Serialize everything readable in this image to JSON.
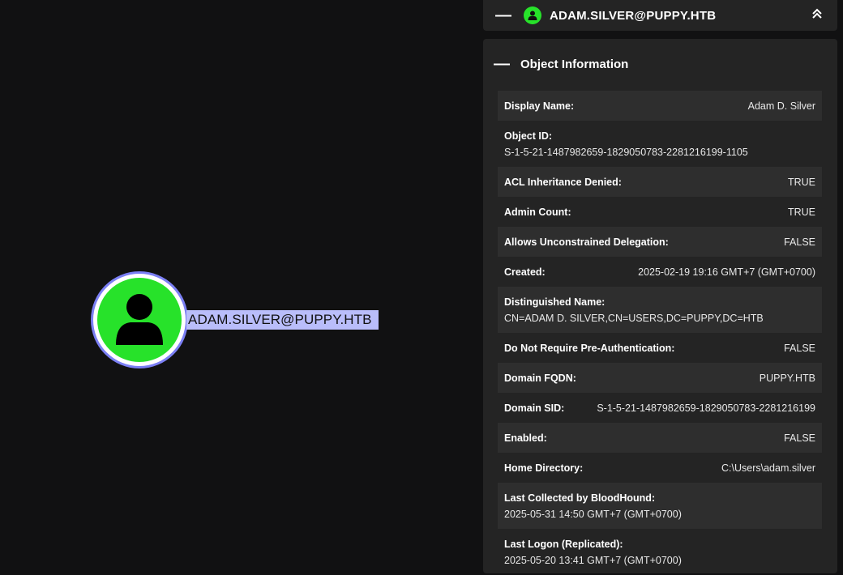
{
  "graph": {
    "node_label": "ADAM.SILVER@PUPPY.HTB",
    "node_icon": "user-icon"
  },
  "panel": {
    "header_title": "ADAM.SILVER@PUPPY.HTB",
    "collapse_symbol": "—",
    "expand_symbol": "⌃⌃",
    "section_title": "Object Information",
    "rows": [
      {
        "key": "Display Name:",
        "value": "Adam D. Silver"
      },
      {
        "key": "Object ID:",
        "value": "S-1-5-21-1487982659-1829050783-2281216199-1105"
      },
      {
        "key": "ACL Inheritance Denied:",
        "value": "TRUE"
      },
      {
        "key": "Admin Count:",
        "value": "TRUE"
      },
      {
        "key": "Allows Unconstrained Delegation:",
        "value": "FALSE"
      },
      {
        "key": "Created:",
        "value": "2025-02-19 19:16 GMT+7 (GMT+0700)"
      },
      {
        "key": "Distinguished Name:",
        "value": "CN=ADAM D. SILVER,CN=USERS,DC=PUPPY,DC=HTB"
      },
      {
        "key": "Do Not Require Pre-Authentication:",
        "value": "FALSE"
      },
      {
        "key": "Domain FQDN:",
        "value": "PUPPY.HTB"
      },
      {
        "key": "Domain SID:",
        "value": "S-1-5-21-1487982659-1829050783-2281216199"
      },
      {
        "key": "Enabled:",
        "value": "FALSE"
      },
      {
        "key": "Home Directory:",
        "value": "C:\\Users\\adam.silver"
      },
      {
        "key": "Last Collected by BloodHound:",
        "value": "2025-05-31 14:50 GMT+7 (GMT+0700)"
      },
      {
        "key": "Last Logon (Replicated):",
        "value": "2025-05-20 13:41 GMT+7 (GMT+0700)"
      }
    ]
  },
  "colors": {
    "node_green": "#27e22a",
    "node_ring": "#7b7ff4",
    "label_bg": "#b9bdfa",
    "panel_bg": "#242424",
    "row_shade": "#2e2e2e"
  }
}
